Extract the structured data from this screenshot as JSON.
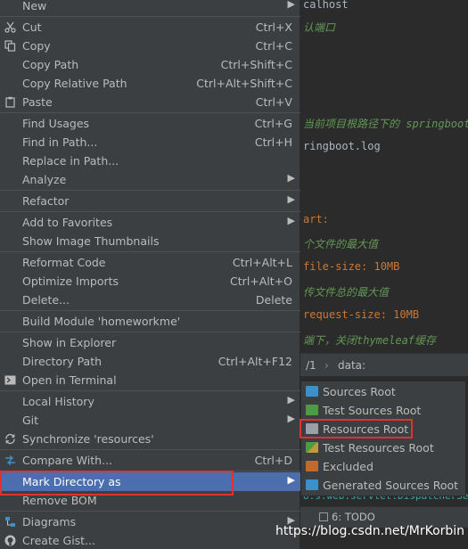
{
  "editor": {
    "lines": [
      {
        "text": "calhost",
        "style": "plain"
      },
      {
        "text": "认端口",
        "style": "comment"
      },
      {
        "text": "当前项目根路径下的 springboot",
        "style": "comment"
      },
      {
        "text": "ringboot.log",
        "style": "plain"
      },
      {
        "text": "art:",
        "style": "key"
      },
      {
        "text": "个文件的最大值",
        "style": "comment"
      },
      {
        "text": "file-size: 10MB",
        "style": "key"
      },
      {
        "text": "传文件总的最大值",
        "style": "comment"
      },
      {
        "text": "request-size: 10MB",
        "style": "key"
      },
      {
        "text": "端下，关闭thymeleaf缓存",
        "style": "comment"
      }
    ]
  },
  "breadcrumb": {
    "left": "/1",
    "sep": "›",
    "right": "data:"
  },
  "console": {
    "line": "o.s.web.servlet.DispatcherSe"
  },
  "bottom_tab": {
    "label": "6: TODO"
  },
  "watermark": "https://blog.csdn.net/MrKorbin",
  "menu": {
    "new": {
      "label": "New"
    },
    "cut": {
      "label": "Cut",
      "shortcut": "Ctrl+X"
    },
    "copy": {
      "label": "Copy",
      "shortcut": "Ctrl+C"
    },
    "copy_path": {
      "label": "Copy Path",
      "shortcut": "Ctrl+Shift+C"
    },
    "copy_relative_path": {
      "label": "Copy Relative Path",
      "shortcut": "Ctrl+Alt+Shift+C"
    },
    "paste": {
      "label": "Paste",
      "shortcut": "Ctrl+V"
    },
    "find_usages": {
      "label": "Find Usages",
      "shortcut": "Ctrl+G"
    },
    "find_in_path": {
      "label": "Find in Path...",
      "shortcut": "Ctrl+H"
    },
    "replace_in_path": {
      "label": "Replace in Path..."
    },
    "analyze": {
      "label": "Analyze"
    },
    "refactor": {
      "label": "Refactor"
    },
    "add_to_favorites": {
      "label": "Add to Favorites"
    },
    "show_thumbnails": {
      "label": "Show Image Thumbnails"
    },
    "reformat_code": {
      "label": "Reformat Code",
      "shortcut": "Ctrl+Alt+L"
    },
    "optimize_imports": {
      "label": "Optimize Imports",
      "shortcut": "Ctrl+Alt+O"
    },
    "delete": {
      "label": "Delete...",
      "shortcut": "Delete"
    },
    "build_module": {
      "label": "Build Module 'homeworkme'"
    },
    "show_in_explorer": {
      "label": "Show in Explorer"
    },
    "directory_path": {
      "label": "Directory Path",
      "shortcut": "Ctrl+Alt+F12"
    },
    "open_in_terminal": {
      "label": "Open in Terminal"
    },
    "local_history": {
      "label": "Local History"
    },
    "git": {
      "label": "Git"
    },
    "synchronize": {
      "label": "Synchronize 'resources'"
    },
    "compare_with": {
      "label": "Compare With...",
      "shortcut": "Ctrl+D"
    },
    "mark_directory_as": {
      "label": "Mark Directory as"
    },
    "remove_bom": {
      "label": "Remove BOM"
    },
    "diagrams": {
      "label": "Diagrams"
    },
    "create_gist": {
      "label": "Create Gist..."
    }
  },
  "submenu": {
    "sources_root": "Sources Root",
    "test_sources_root": "Test Sources Root",
    "resources_root": "Resources Root",
    "test_resources_root": "Test Resources Root",
    "excluded": "Excluded",
    "generated_sources_root": "Generated Sources Root"
  },
  "colors": {
    "menu_bg": "#3c3f41",
    "selection": "#4b6eaf",
    "highlight_box": "#e0322f",
    "sources_folder": "#3d8fc7",
    "test_folder": "#4f9a45",
    "resources_folder": "#9aa0a6",
    "excluded_folder": "#c06a2b"
  }
}
